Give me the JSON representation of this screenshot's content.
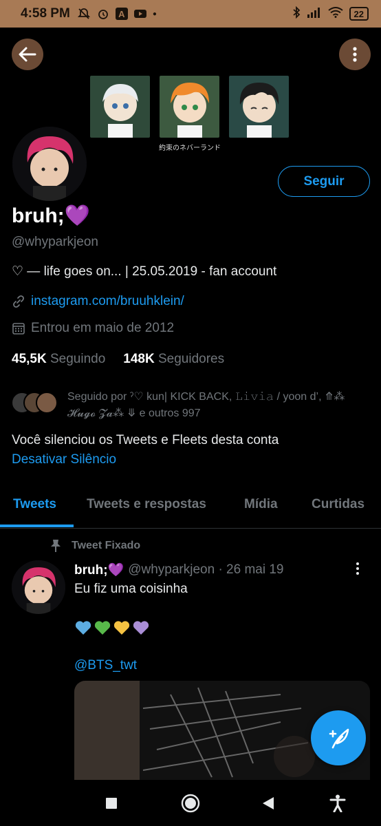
{
  "status_bar": {
    "time": "4:58 PM",
    "battery": "22",
    "icons": [
      "mute-icon",
      "alarm-icon",
      "app-a-icon",
      "youtube-icon",
      "dot-icon",
      "bluetooth-icon",
      "signal-icon",
      "wifi-icon",
      "battery-icon"
    ]
  },
  "banner": {
    "caption": "約束のネバーランド"
  },
  "profile": {
    "follow_label": "Seguir",
    "display_name": "bruh;💜",
    "handle": "@whyparkjeon",
    "bio": "♡ — life goes on... | 25.05.2019 - fan account",
    "link": "instagram.com/bruuhklein/",
    "joined": "Entrou em maio de 2012",
    "following_count": "45,5K",
    "following_label": "Seguindo",
    "followers_count": "148K",
    "followers_label": "Seguidores",
    "followed_by": "Seguido por ˀ♡ kun| KICK BACK, 𝙻𝚒𝚟𝚒𝚊 / yoon d’, ⤊⁂ 𝓗𝓾𝓰𝓸 𝓩𝓪⁂ ⤋ e outros 997",
    "muted_notice": "Você silenciou os Tweets e Fleets desta conta",
    "unmute_label": "Desativar Silêncio"
  },
  "tabs": [
    {
      "label": "Tweets",
      "active": true
    },
    {
      "label": "Tweets e respostas",
      "active": false
    },
    {
      "label": "Mídia",
      "active": false
    },
    {
      "label": "Curtidas",
      "active": false
    }
  ],
  "tweet": {
    "pinned_label": "Tweet Fixado",
    "name": "bruh;💜",
    "handle_date": "@whyparkjeon · 26 mai 19",
    "text": "Eu fiz uma coisinha",
    "hearts": "💙💚💛💜",
    "mention": "@BTS_twt"
  },
  "colors": {
    "accent": "#1d9bf0",
    "status_bar": "#a87a55",
    "round_button": "#6b4a35",
    "secondary_text": "#71767b",
    "background": "#000000"
  }
}
